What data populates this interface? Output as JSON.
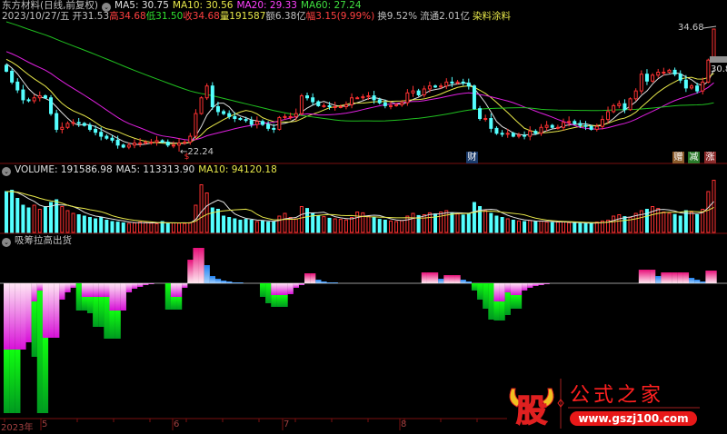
{
  "header": {
    "title": "东方材料(日线,前复权)",
    "ma5": "MA5: 30.75",
    "ma10": "MA10: 30.56",
    "ma20": "MA20: 29.33",
    "ma60": "MA60: 27.24",
    "date": "2023/10/27/五",
    "open": "开31.53",
    "high": "高34.68",
    "low": "低31.50",
    "close": "收34.68",
    "volume": "量191587",
    "amount": "额6.38亿",
    "change": "幅3.15(9.99%)",
    "turnover": "换9.52%",
    "float": "流通2.01亿",
    "sector": "染料涂料"
  },
  "price_labels": {
    "high": "34.68",
    "low": "22.24",
    "right": "30.8"
  },
  "markers": {
    "dollar": "$",
    "finance": "财",
    "gift": "赠",
    "reduce": "减",
    "rise": "涨"
  },
  "volume_header": {
    "volume": "VOLUME: 191586.98",
    "ma5": "MA5: 113313.90",
    "ma10": "MA10: 94120.18"
  },
  "indicator_header": {
    "title": "吸筹拉高出货"
  },
  "x_axis": {
    "year": "2023年",
    "months": [
      "5",
      "6",
      "7",
      "8"
    ]
  },
  "watermark": {
    "logo": "股",
    "name": "公式之家",
    "url": "www.gszj100.com"
  },
  "colors": {
    "up": "#ff3232",
    "down": "#54ffff",
    "ma5": "#e0e0e0",
    "ma10": "#e8e84a",
    "ma20": "#e020e0",
    "ma60": "#20c020",
    "divider": "#7a1010"
  },
  "chart_data": {
    "type": "candlestick",
    "title": "东方材料(日线,前复权)",
    "last": {
      "open": 31.53,
      "high": 34.68,
      "low": 31.5,
      "close": 34.68
    },
    "lowest": {
      "value": 22.24,
      "index": 31
    },
    "closes": [
      30.4,
      29.3,
      28.5,
      27.5,
      27.4,
      27.7,
      27.9,
      27.7,
      26.1,
      24.5,
      24.7,
      25.1,
      25.2,
      25.1,
      24.9,
      24.5,
      24.2,
      23.8,
      23.6,
      23.4,
      22.9,
      22.7,
      22.9,
      23.1,
      23.1,
      23.2,
      23.2,
      23.35,
      23.2,
      22.9,
      22.9,
      23.1,
      23.2,
      23.8,
      26.1,
      27.7,
      28.9,
      26.8,
      26.3,
      26.1,
      25.8,
      25.6,
      25.5,
      25.4,
      25.0,
      25.3,
      25.0,
      24.6,
      24.5,
      25.7,
      25.8,
      25.8,
      26.1,
      27.9,
      27.7,
      27.3,
      26.9,
      26.9,
      26.8,
      26.8,
      26.8,
      27.0,
      27.7,
      27.7,
      27.8,
      27.9,
      27.5,
      27.2,
      26.9,
      26.9,
      27.0,
      27.2,
      28.2,
      28.4,
      28.0,
      28.6,
      28.9,
      28.8,
      28.9,
      29.3,
      29.2,
      29.3,
      29.2,
      28.9,
      26.6,
      25.6,
      25.6,
      24.6,
      24.1,
      24.0,
      24.1,
      23.8,
      23.9,
      23.8,
      24.3,
      24.1,
      24.7,
      24.9,
      24.7,
      24.7,
      25.2,
      25.3,
      25.1,
      24.9,
      24.8,
      24.5,
      24.8,
      25.5,
      26.3,
      26.9,
      27.1,
      26.5,
      27.6,
      28.4,
      30.1,
      29.4,
      30.0,
      30.3,
      30.3,
      30.5,
      30.1,
      29.5,
      28.7,
      28.9,
      28.4,
      29.3,
      31.53,
      34.68
    ],
    "volumes_k": [
      150,
      155,
      125,
      100,
      90,
      100,
      85,
      95,
      110,
      120,
      95,
      80,
      70,
      65,
      60,
      55,
      50,
      55,
      45,
      40,
      38,
      35,
      33,
      35,
      38,
      36,
      34,
      32,
      40,
      35,
      35,
      34,
      33,
      36,
      100,
      175,
      145,
      90,
      85,
      60,
      55,
      50,
      45,
      48,
      45,
      40,
      42,
      38,
      40,
      60,
      70,
      55,
      50,
      95,
      88,
      70,
      60,
      58,
      52,
      50,
      48,
      46,
      55,
      75,
      72,
      60,
      55,
      48,
      45,
      42,
      40,
      44,
      60,
      70,
      62,
      65,
      72,
      68,
      75,
      80,
      70,
      68,
      64,
      70,
      110,
      95,
      80,
      70,
      60,
      55,
      50,
      45,
      42,
      40,
      44,
      40,
      42,
      38,
      36,
      38,
      40,
      36,
      34,
      33,
      32,
      35,
      38,
      42,
      45,
      60,
      65,
      58,
      55,
      70,
      80,
      85,
      95,
      88,
      75,
      70,
      66,
      60,
      80,
      75,
      65,
      85,
      150,
      191.587
    ],
    "indicator_negative": {
      "0": [
        73,
        70
      ],
      "1": [
        73,
        70
      ],
      "2": [
        73,
        70
      ],
      "3": [
        73,
        0
      ],
      "4": [
        65,
        0
      ],
      "5": [
        20,
        61
      ],
      "6": [
        8,
        135
      ],
      "7": [
        60,
        83
      ],
      "8": [
        60,
        0
      ],
      "9": [
        60,
        0
      ],
      "10": [
        18,
        0
      ],
      "11": [
        10,
        0
      ],
      "12": [
        5,
        0
      ],
      "13": [
        0,
        30
      ],
      "14": [
        15,
        15
      ],
      "15": [
        15,
        18
      ],
      "16": [
        15,
        33
      ],
      "17": [
        15,
        33
      ],
      "18": [
        15,
        46
      ],
      "19": [
        30,
        31
      ],
      "20": [
        30,
        31
      ],
      "21": [
        30,
        0
      ],
      "22": [
        10,
        0
      ],
      "23": [
        6,
        0
      ],
      "24": [
        4,
        0
      ],
      "25": [
        2,
        0
      ],
      "26": [
        1,
        0
      ],
      "29": [
        0,
        29
      ],
      "30": [
        15,
        14
      ],
      "31": [
        15,
        14
      ],
      "32": [
        5,
        0
      ],
      "46": [
        0,
        15
      ],
      "47": [
        0,
        22
      ],
      "48": [
        13,
        13
      ],
      "49": [
        13,
        13
      ],
      "50": [
        13,
        13
      ],
      "51": [
        12,
        0
      ],
      "52": [
        5,
        0
      ],
      "53": [
        2,
        0
      ],
      "84": [
        0,
        8
      ],
      "85": [
        0,
        18
      ],
      "86": [
        0,
        28
      ],
      "87": [
        0,
        40
      ],
      "88": [
        20,
        21
      ],
      "89": [
        20,
        21
      ],
      "90": [
        10,
        25
      ],
      "91": [
        13,
        15
      ],
      "92": [
        13,
        15
      ],
      "93": [
        8,
        0
      ],
      "94": [
        5,
        0
      ],
      "95": [
        3,
        0
      ],
      "96": [
        2,
        0
      ],
      "97": [
        1,
        0
      ]
    },
    "indicator_positive": {
      "33": [
        "pink",
        26
      ],
      "34": [
        "pink",
        39
      ],
      "35": [
        "pink",
        39
      ],
      "36": [
        "blue",
        20
      ],
      "37": [
        "blue",
        8
      ],
      "38": [
        "blue",
        5
      ],
      "39": [
        "blue",
        3
      ],
      "40": [
        "blue",
        2
      ],
      "41": [
        "blue",
        1
      ],
      "42": [
        "blue",
        1
      ],
      "54": [
        "pink",
        11
      ],
      "55": [
        "pink",
        11
      ],
      "56": [
        "blue",
        4
      ],
      "57": [
        "blue",
        2
      ],
      "58": [
        "blue",
        1
      ],
      "59": [
        "blue",
        1
      ],
      "75": [
        "pink",
        12
      ],
      "76": [
        "pink",
        12
      ],
      "77": [
        "pink",
        12
      ],
      "78": [
        "blue",
        5
      ],
      "79": [
        "pink",
        9
      ],
      "80": [
        "pink",
        9
      ],
      "81": [
        "pink",
        9
      ],
      "82": [
        "blue",
        4
      ],
      "83": [
        "blue",
        2
      ],
      "114": [
        "pink",
        15
      ],
      "115": [
        "pink",
        15
      ],
      "116": [
        "pink",
        15
      ],
      "117": [
        "blue",
        8
      ],
      "118": [
        "pink",
        12
      ],
      "119": [
        "pink",
        12
      ],
      "120": [
        "pink",
        12
      ],
      "121": [
        "pink",
        12
      ],
      "122": [
        "pink",
        12
      ],
      "123": [
        "blue",
        6
      ],
      "124": [
        "blue",
        4
      ],
      "125": [
        "blue",
        2
      ],
      "126": [
        "pink",
        14
      ],
      "127": [
        "pink",
        14
      ]
    }
  }
}
